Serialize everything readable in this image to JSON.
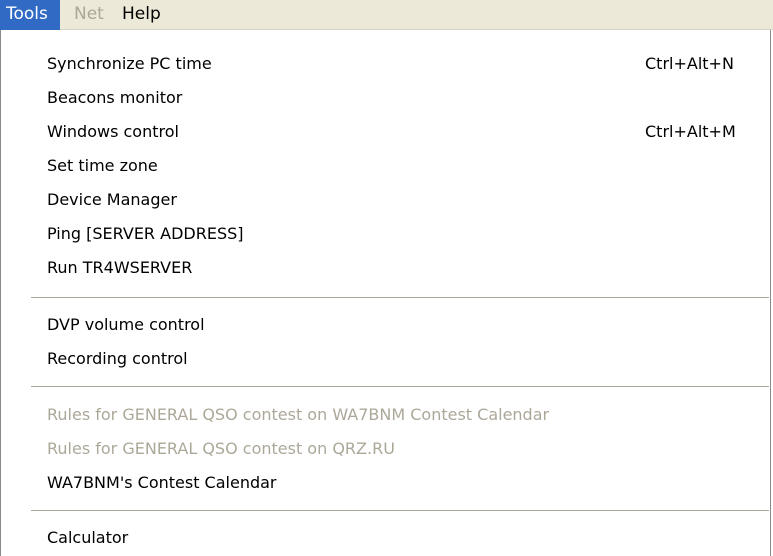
{
  "menubar": {
    "items": [
      {
        "label": "Tools",
        "state": "active"
      },
      {
        "label": "Net",
        "state": "disabled"
      },
      {
        "label": "Help",
        "state": "normal"
      }
    ]
  },
  "tools_menu": {
    "groups": [
      {
        "items": [
          {
            "label": "Synchronize PC time",
            "shortcut": "Ctrl+Alt+N",
            "enabled": true
          },
          {
            "label": "Beacons monitor",
            "shortcut": "",
            "enabled": true
          },
          {
            "label": "Windows control",
            "shortcut": "Ctrl+Alt+M",
            "enabled": true
          },
          {
            "label": "Set time zone",
            "shortcut": "",
            "enabled": true
          },
          {
            "label": "Device Manager",
            "shortcut": "",
            "enabled": true
          },
          {
            "label": "Ping [SERVER ADDRESS]",
            "shortcut": "",
            "enabled": true
          },
          {
            "label": "Run TR4WSERVER",
            "shortcut": "",
            "enabled": true
          }
        ]
      },
      {
        "items": [
          {
            "label": "DVP volume control",
            "shortcut": "",
            "enabled": true
          },
          {
            "label": "Recording control",
            "shortcut": "",
            "enabled": true
          }
        ]
      },
      {
        "items": [
          {
            "label": "Rules for GENERAL QSO contest on WA7BNM Contest Calendar",
            "shortcut": "",
            "enabled": false
          },
          {
            "label": "Rules for GENERAL QSO contest on QRZ.RU",
            "shortcut": "",
            "enabled": false
          },
          {
            "label": "WA7BNM's Contest Calendar",
            "shortcut": "",
            "enabled": true
          }
        ]
      },
      {
        "items": [
          {
            "label": "Calculator",
            "shortcut": "",
            "enabled": true
          }
        ]
      }
    ]
  }
}
